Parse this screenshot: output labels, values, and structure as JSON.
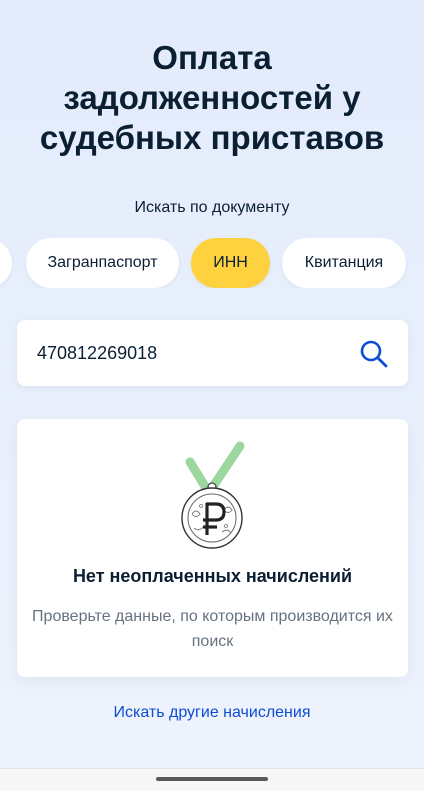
{
  "header": {
    "title_lines": [
      "Оплата",
      "задолженностей у",
      "судебных приставов"
    ]
  },
  "search_by": {
    "label": "Искать по документу",
    "chips": [
      {
        "label": "",
        "selected": false
      },
      {
        "label": "Загранпаспорт",
        "selected": false
      },
      {
        "label": "ИНН",
        "selected": true
      },
      {
        "label": "Квитанция",
        "selected": false
      }
    ]
  },
  "search": {
    "value": "470812269018",
    "icon": "search-icon"
  },
  "result": {
    "icon": "ruble-medal-check-icon",
    "title": "Нет неоплаченных начислений",
    "description": "Проверьте данные, по которым производится их поиск"
  },
  "footer": {
    "link_label": "Искать другие начисления"
  },
  "colors": {
    "background": "#e3ebfb",
    "accent_selected_chip": "#fed13e",
    "link": "#0d4cd3",
    "text_primary": "#0b1f33",
    "text_secondary": "#66727f",
    "check_green": "#9cd7a0"
  }
}
